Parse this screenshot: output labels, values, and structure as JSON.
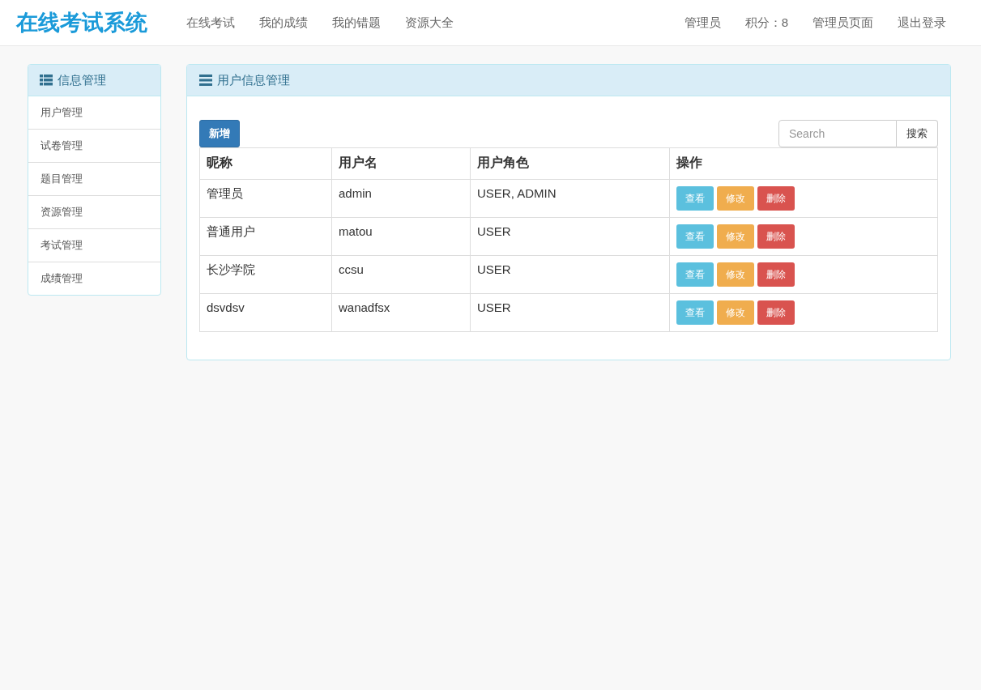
{
  "navbar": {
    "brand": "在线考试系统",
    "links": [
      "在线考试",
      "我的成绩",
      "我的错题",
      "资源大全"
    ],
    "right_links": [
      "管理员",
      "积分：8",
      "管理员页面",
      "退出登录"
    ]
  },
  "sidebar": {
    "title": "信息管理",
    "items": [
      "用户管理",
      "试卷管理",
      "题目管理",
      "资源管理",
      "考试管理",
      "成绩管理"
    ]
  },
  "panel": {
    "title": "用户信息管理",
    "add_button": "新增",
    "search": {
      "placeholder": "Search",
      "button": "搜索"
    },
    "table": {
      "columns": [
        "昵称",
        "用户名",
        "用户角色",
        "操作"
      ],
      "rows": [
        {
          "cells": [
            "管理员",
            "admin",
            "USER, ADMIN"
          ],
          "actions": [
            {
              "kind": "view",
              "label": "查看"
            },
            {
              "kind": "edit",
              "label": "修改"
            },
            {
              "kind": "delete",
              "label": "删除"
            }
          ]
        },
        {
          "cells": [
            "普通用户",
            "matou",
            "USER"
          ],
          "actions": [
            {
              "kind": "view",
              "label": "查看"
            },
            {
              "kind": "edit",
              "label": "修改"
            },
            {
              "kind": "delete",
              "label": "删除"
            }
          ]
        },
        {
          "cells": [
            "长沙学院",
            "ccsu",
            "USER"
          ],
          "actions": [
            {
              "kind": "view",
              "label": "查看"
            },
            {
              "kind": "edit",
              "label": "修改"
            },
            {
              "kind": "delete",
              "label": "删除"
            }
          ]
        },
        {
          "cells": [
            "dsvdsv",
            "wanadfsx",
            "USER"
          ],
          "actions": [
            {
              "kind": "view",
              "label": "查看"
            },
            {
              "kind": "edit",
              "label": "修改"
            },
            {
              "kind": "delete",
              "label": "删除"
            }
          ]
        }
      ]
    }
  }
}
